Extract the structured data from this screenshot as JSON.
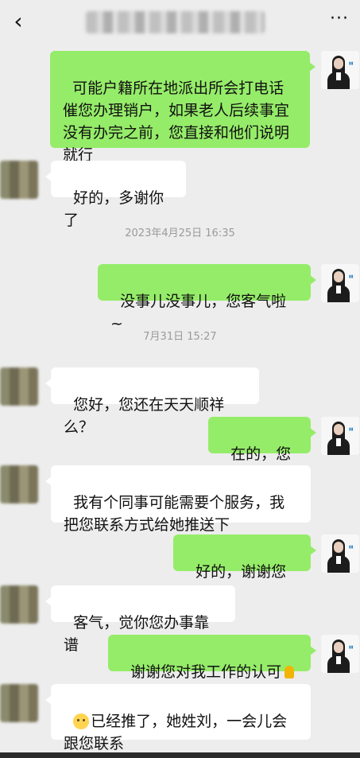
{
  "header": {
    "back_icon": "back-chevron-icon",
    "more_icon": "more-dots-icon",
    "more_label": "···"
  },
  "messages": [
    {
      "side": "me",
      "text": "可能户籍所在地派出所会打电话催您办理销户，如果老人后续事宜没有办完之前，您直接和他们说明就行"
    },
    {
      "side": "them",
      "text": "好的，多谢你了"
    },
    {
      "type": "time",
      "text": "2023年4月25日 16:35"
    },
    {
      "side": "me",
      "text": "没事儿没事儿，您客气啦~"
    },
    {
      "type": "time",
      "text": "7月31日 15:27"
    },
    {
      "side": "them",
      "text": "您好，您还在天天顺祥么？"
    },
    {
      "side": "me",
      "text": "在的，您说"
    },
    {
      "side": "them",
      "text": "我有个同事可能需要个服务，我把您联系方式给她推送下"
    },
    {
      "side": "me",
      "text": "好的，谢谢您",
      "emoji": "pray-icon"
    },
    {
      "side": "them",
      "text": "客气，觉你您办事靠谱"
    },
    {
      "side": "me",
      "text": "谢谢您对我工作的认可",
      "emoji": "pray-icon"
    },
    {
      "side": "them",
      "text": "已经推了，她姓刘，一会儿会跟您联系",
      "emoji_before": "smile-icon"
    }
  ],
  "colors": {
    "background": "#ededed",
    "me_bubble": "#95ec69",
    "them_bubble": "#ffffff",
    "timestamp": "#9a9a9a"
  }
}
